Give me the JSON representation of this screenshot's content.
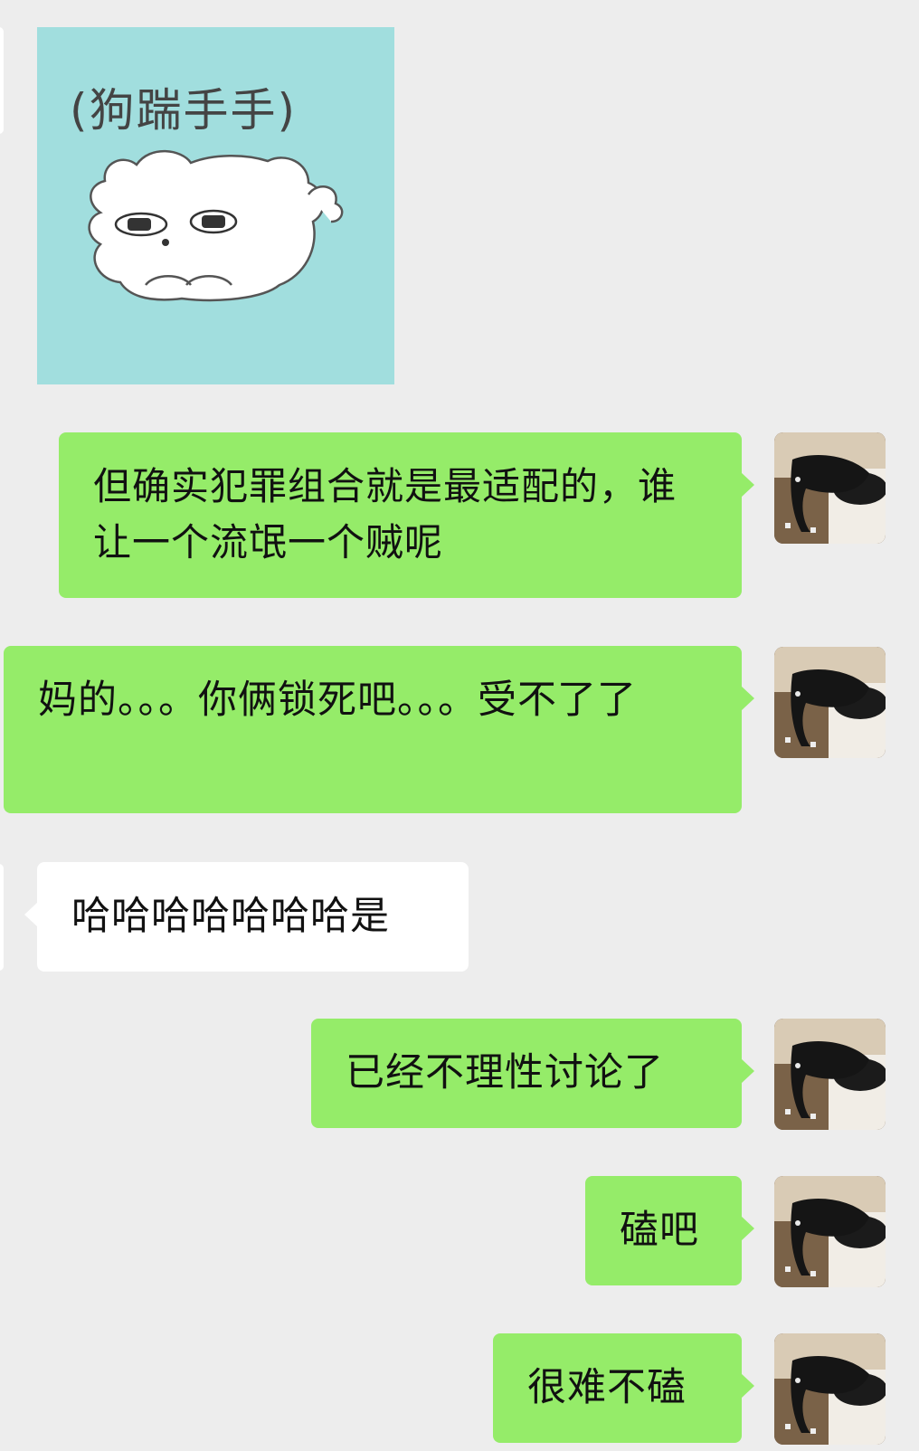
{
  "sticker": {
    "caption": "(狗踹手手)",
    "background": "#a1dede"
  },
  "messages": [
    {
      "side": "out",
      "text": "但确实犯罪组合就是最适配的，谁让一个流氓一个贼呢"
    },
    {
      "side": "out",
      "text": "妈的。。。你俩锁死吧。。。受不了了"
    },
    {
      "side": "in",
      "text": "哈哈哈哈哈哈哈是"
    },
    {
      "side": "out",
      "text": "已经不理性讨论了"
    },
    {
      "side": "out",
      "text": "磕吧"
    },
    {
      "side": "out",
      "text": "很难不磕"
    }
  ],
  "avatar": {
    "icon": "cat-on-toilet-avatar"
  },
  "colors": {
    "background": "#ededed",
    "outgoing_bubble": "#95ec69",
    "incoming_bubble": "#ffffff"
  }
}
